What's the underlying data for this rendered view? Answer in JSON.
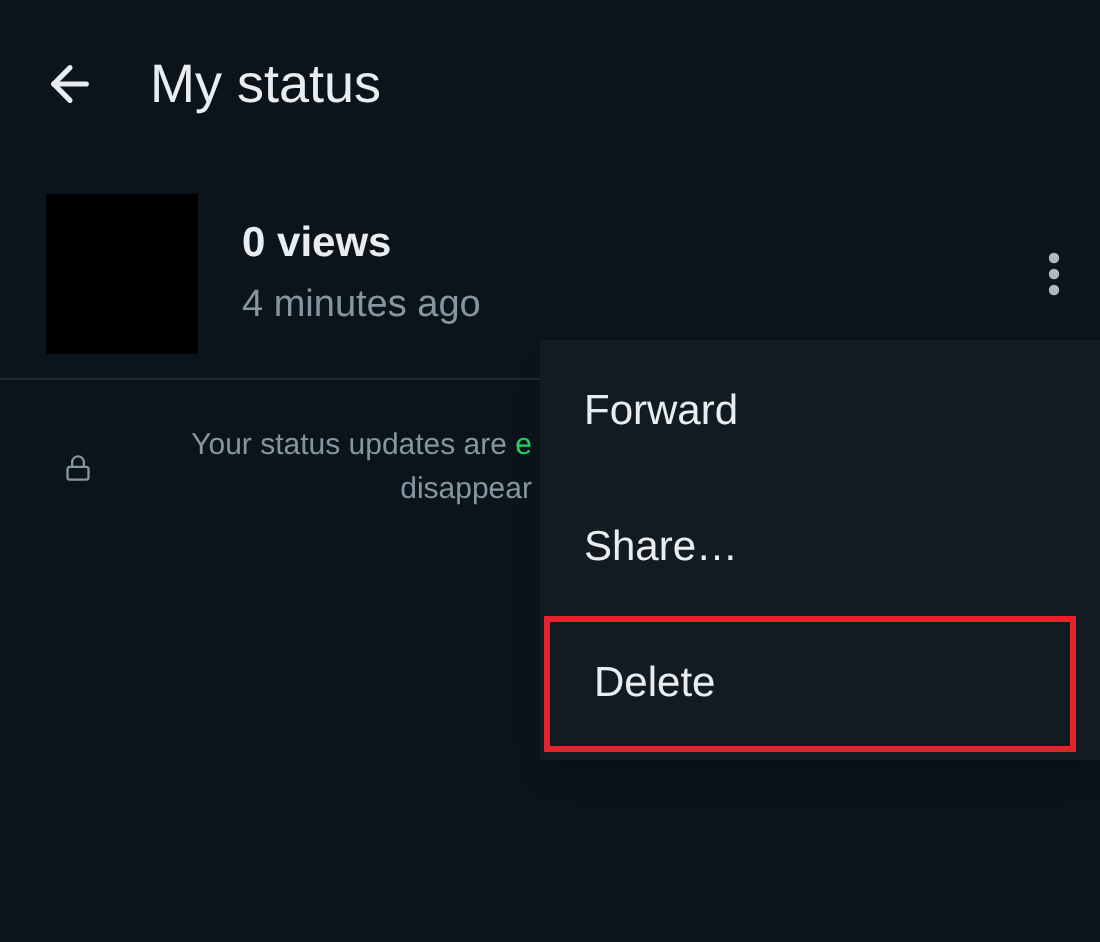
{
  "header": {
    "title": "My status"
  },
  "status": {
    "views": "0 views",
    "time": "4 minutes ago"
  },
  "notice": {
    "line1": "Your status updates are ",
    "highlight": "e",
    "line2": "disappear"
  },
  "menu": {
    "items": [
      {
        "label": "Forward",
        "highlighted": false
      },
      {
        "label": "Share…",
        "highlighted": false
      },
      {
        "label": "Delete",
        "highlighted": true
      }
    ]
  }
}
